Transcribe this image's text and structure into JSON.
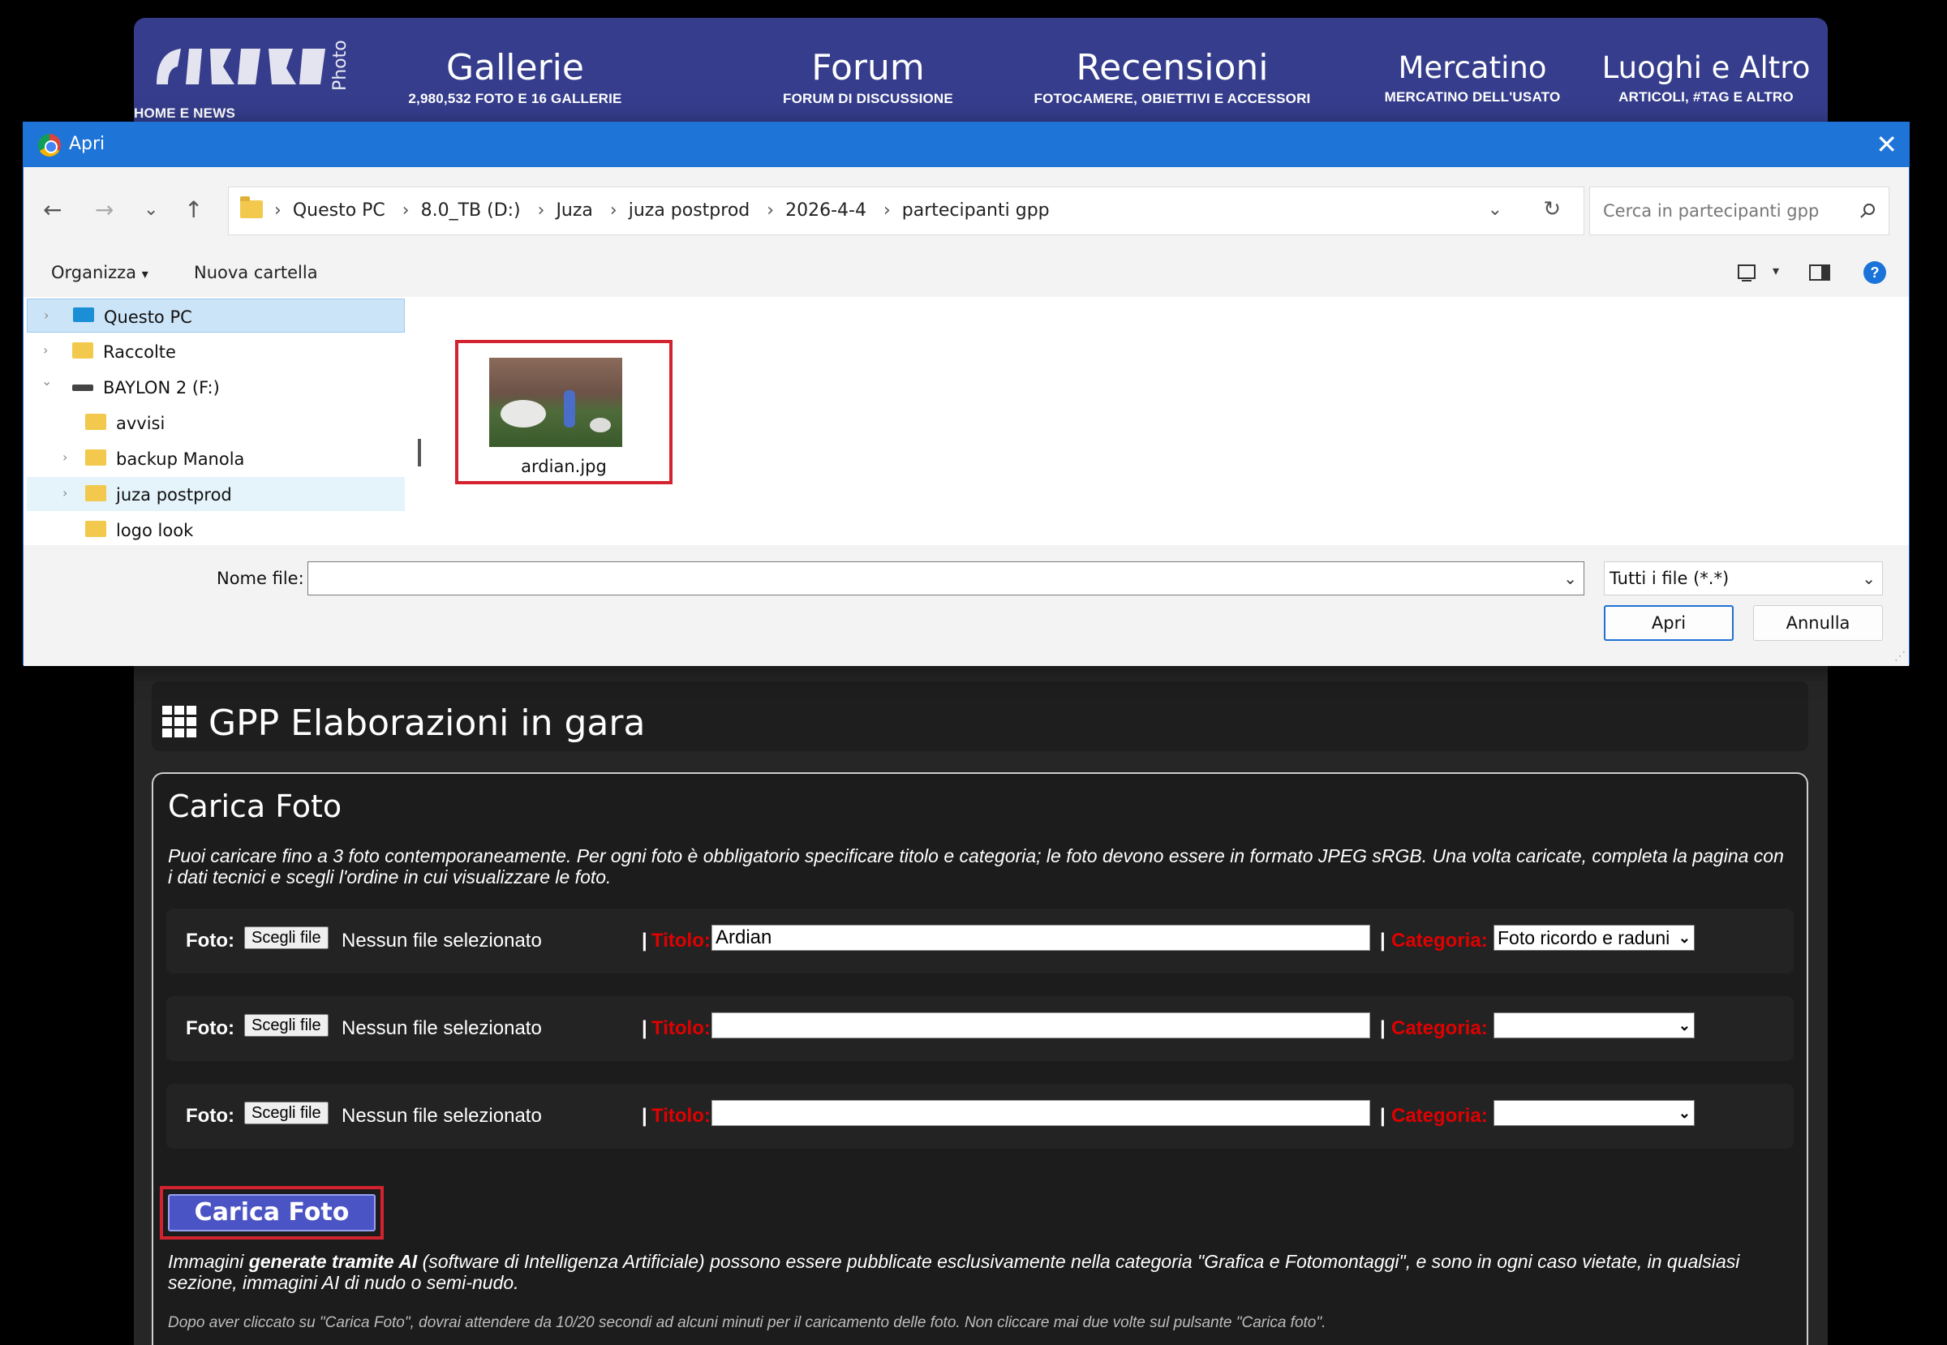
{
  "site": {
    "logo_photo_label": "Photo",
    "nav": [
      {
        "title": "Gallerie",
        "sub": "2,980,532 FOTO E 16 GALLERIE"
      },
      {
        "title": "Forum",
        "sub": "FORUM DI DISCUSSIONE"
      },
      {
        "title": "Recensioni",
        "sub": "FOTOCAMERE, OBIETTIVI E ACCESSORI"
      },
      {
        "title": "Mercatino",
        "sub": "MERCATINO DELL'USATO"
      },
      {
        "title": "Luoghi e Altro",
        "sub": "ARTICOLI, #TAG E ALTRO"
      }
    ],
    "home_sub": "HOME E NEWS",
    "header_color": "#353d8c"
  },
  "section": {
    "title": "GPP Elaborazioni in gara"
  },
  "upload": {
    "title": "Carica Foto",
    "description": "Puoi caricare fino a 3 foto contemporaneamente. Per ogni foto è obbligatorio specificare titolo e categoria; le foto devono essere in formato JPEG sRGB. Una volta caricate, completa la pagina con i dati tecnici e scegli l'ordine in cui visualizzare le foto.",
    "foto_label": "Foto:",
    "choose_button": "Scegli file",
    "no_file": "Nessun file selezionato",
    "pipe": "|",
    "titolo_label": "Titolo:",
    "categoria_label": "Categoria:",
    "rows": [
      {
        "titolo": "Ardian",
        "categoria": "Foto ricordo e raduni"
      },
      {
        "titolo": "",
        "categoria": ""
      },
      {
        "titolo": "",
        "categoria": ""
      }
    ],
    "submit_label": "Carica Foto",
    "ai_note_prefix": "Immagini ",
    "ai_note_bold": "generate tramite AI",
    "ai_note_rest": " (software di Intelligenza Artificiale) possono essere pubblicate esclusivamente nella categoria \"Grafica e Fotomontaggi\", e sono in ogni caso vietate, in qualsiasi sezione, immagini AI di nudo o semi-nudo.",
    "wait_note": "Dopo aver cliccato su \"Carica Foto\", dovrai attendere da 10/20 secondi ad alcuni minuti per il caricamento delle foto. Non cliccare mai due volte sul pulsante \"Carica foto\"."
  },
  "dialog": {
    "title": "Apri",
    "close_glyph": "✕",
    "breadcrumbs": [
      "Questo PC",
      "8.0_TB (D:)",
      "Juza",
      "juza postprod",
      "2026-4-4",
      "partecipanti gpp"
    ],
    "search_placeholder": "Cerca in partecipanti gpp",
    "organize": "Organizza",
    "new_folder": "Nuova cartella",
    "help_glyph": "?",
    "tree": [
      {
        "label": "Questo PC",
        "type": "pc",
        "indent": 0,
        "arrow": "›",
        "selected": true
      },
      {
        "label": "Raccolte",
        "type": "folder",
        "indent": 0,
        "arrow": "›"
      },
      {
        "label": "BAYLON 2 (F:)",
        "type": "drive",
        "indent": 0,
        "arrow": "⌄"
      },
      {
        "label": "avvisi",
        "type": "folder",
        "indent": 1,
        "arrow": ""
      },
      {
        "label": "backup Manola",
        "type": "folder",
        "indent": 1,
        "arrow": "›"
      },
      {
        "label": "juza postprod",
        "type": "folder",
        "indent": 1,
        "arrow": "›",
        "hover": true
      },
      {
        "label": "logo look",
        "type": "folder",
        "indent": 1,
        "arrow": ""
      }
    ],
    "file": {
      "name": "ardian.jpg"
    },
    "filename_label": "Nome file:",
    "filename_value": "",
    "filetype": "Tutti i file (*.*)",
    "open_button": "Apri",
    "cancel_button": "Annulla"
  }
}
